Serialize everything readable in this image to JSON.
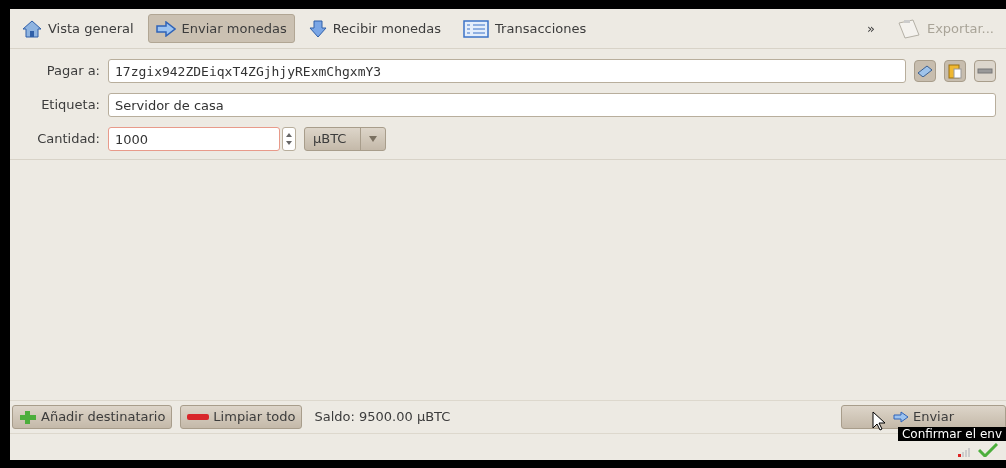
{
  "tabs": [
    {
      "label": "Vista general",
      "selected": false
    },
    {
      "label": "Enviar monedas",
      "selected": true
    },
    {
      "label": "Recibir monedas",
      "selected": false
    },
    {
      "label": "Transacciones",
      "selected": false
    }
  ],
  "overflow": "»",
  "export": {
    "label": "Exportar...",
    "disabled": true
  },
  "form": {
    "pay_to": {
      "label": "Pagar a:",
      "value": "17zgix942ZDEiqxT4ZGjhjyRExmChgxmY3"
    },
    "label": {
      "label": "Etiqueta:",
      "value": "Servidor de casa"
    },
    "amount": {
      "label": "Cantidad:",
      "value": "1000",
      "unit": "µBTC"
    }
  },
  "actions": {
    "add": "Añadir destinatario",
    "clear": "Limpiar todo",
    "balance": "Saldo: 9500.00 µBTC",
    "send": "Enviar"
  },
  "tooltip": "Confirmar el env",
  "status": {
    "synced": true
  }
}
